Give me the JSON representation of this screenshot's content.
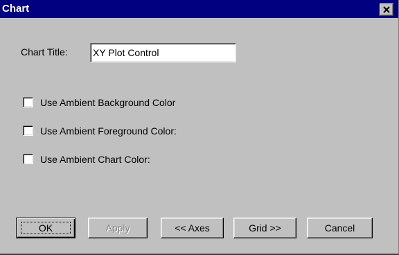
{
  "window": {
    "title": "Chart",
    "close_label": "close"
  },
  "form": {
    "chart_title_label": "Chart Title:",
    "chart_title_value": "XY Plot Control"
  },
  "options": [
    {
      "label": "Use Ambient Background Color",
      "checked": false
    },
    {
      "label": "Use Ambient Foreground Color:",
      "checked": false
    },
    {
      "label": "Use Ambient Chart Color:",
      "checked": false
    }
  ],
  "buttons": {
    "ok": "OK",
    "apply": "Apply",
    "axes": "<< Axes",
    "grid": "Grid >>",
    "cancel": "Cancel"
  },
  "colors": {
    "titlebar": "#000080",
    "face": "#c0c0c0"
  }
}
